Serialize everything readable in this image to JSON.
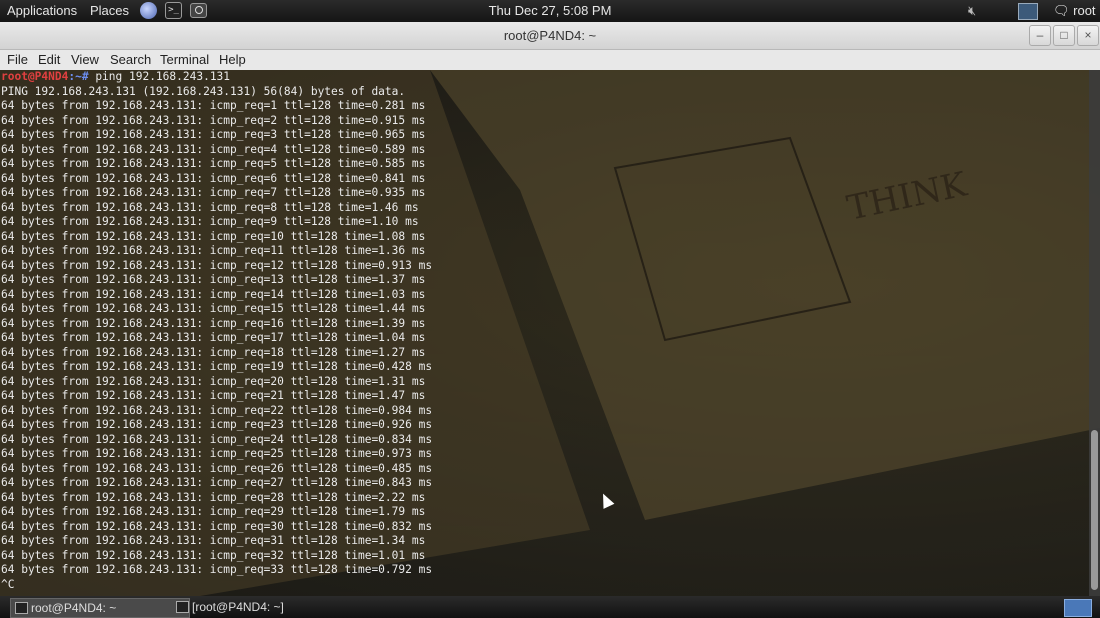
{
  "top_panel": {
    "applications": "Applications",
    "places": "Places",
    "clock": "Thu Dec 27,  5:08 PM",
    "user": "root",
    "icons": [
      "browser-icon",
      "terminal-icon",
      "screenshot-icon",
      "volume-muted-icon",
      "network-icon",
      "chat-icon"
    ]
  },
  "window": {
    "title": "root@P4ND4: ~",
    "minimize": "–",
    "maximize": "□",
    "close": "×"
  },
  "menubar": {
    "file": "File",
    "edit": "Edit",
    "view": "View",
    "search": "Search",
    "terminal": "Terminal",
    "help": "Help"
  },
  "terminal": {
    "prompt_user": "root@P4ND4",
    "prompt_path": ":~#",
    "command": " ping 192.168.243.131",
    "header": "PING 192.168.243.131 (192.168.243.131) 56(84) bytes of data.",
    "lines": [
      "64 bytes from 192.168.243.131: icmp_req=1 ttl=128 time=0.281 ms",
      "64 bytes from 192.168.243.131: icmp_req=2 ttl=128 time=0.915 ms",
      "64 bytes from 192.168.243.131: icmp_req=3 ttl=128 time=0.965 ms",
      "64 bytes from 192.168.243.131: icmp_req=4 ttl=128 time=0.589 ms",
      "64 bytes from 192.168.243.131: icmp_req=5 ttl=128 time=0.585 ms",
      "64 bytes from 192.168.243.131: icmp_req=6 ttl=128 time=0.841 ms",
      "64 bytes from 192.168.243.131: icmp_req=7 ttl=128 time=0.935 ms",
      "64 bytes from 192.168.243.131: icmp_req=8 ttl=128 time=1.46 ms",
      "64 bytes from 192.168.243.131: icmp_req=9 ttl=128 time=1.10 ms",
      "64 bytes from 192.168.243.131: icmp_req=10 ttl=128 time=1.08 ms",
      "64 bytes from 192.168.243.131: icmp_req=11 ttl=128 time=1.36 ms",
      "64 bytes from 192.168.243.131: icmp_req=12 ttl=128 time=0.913 ms",
      "64 bytes from 192.168.243.131: icmp_req=13 ttl=128 time=1.37 ms",
      "64 bytes from 192.168.243.131: icmp_req=14 ttl=128 time=1.03 ms",
      "64 bytes from 192.168.243.131: icmp_req=15 ttl=128 time=1.44 ms",
      "64 bytes from 192.168.243.131: icmp_req=16 ttl=128 time=1.39 ms",
      "64 bytes from 192.168.243.131: icmp_req=17 ttl=128 time=1.04 ms",
      "64 bytes from 192.168.243.131: icmp_req=18 ttl=128 time=1.27 ms",
      "64 bytes from 192.168.243.131: icmp_req=19 ttl=128 time=0.428 ms",
      "64 bytes from 192.168.243.131: icmp_req=20 ttl=128 time=1.31 ms",
      "64 bytes from 192.168.243.131: icmp_req=21 ttl=128 time=1.47 ms",
      "64 bytes from 192.168.243.131: icmp_req=22 ttl=128 time=0.984 ms",
      "64 bytes from 192.168.243.131: icmp_req=23 ttl=128 time=0.926 ms",
      "64 bytes from 192.168.243.131: icmp_req=24 ttl=128 time=0.834 ms",
      "64 bytes from 192.168.243.131: icmp_req=25 ttl=128 time=0.973 ms",
      "64 bytes from 192.168.243.131: icmp_req=26 ttl=128 time=0.485 ms",
      "64 bytes from 192.168.243.131: icmp_req=27 ttl=128 time=0.843 ms",
      "64 bytes from 192.168.243.131: icmp_req=28 ttl=128 time=2.22 ms",
      "64 bytes from 192.168.243.131: icmp_req=29 ttl=128 time=1.79 ms",
      "64 bytes from 192.168.243.131: icmp_req=30 ttl=128 time=0.832 ms",
      "64 bytes from 192.168.243.131: icmp_req=31 ttl=128 time=1.34 ms",
      "64 bytes from 192.168.243.131: icmp_req=32 ttl=128 time=1.01 ms",
      "64 bytes from 192.168.243.131: icmp_req=33 ttl=128 time=0.792 ms"
    ],
    "interrupt": "^C",
    "wallpaper_text": "THINK"
  },
  "taskbar": {
    "task1": "root@P4ND4: ~",
    "task2": "[root@P4ND4: ~]"
  },
  "colors": {
    "prompt_user": "#e04040",
    "prompt_path": "#6c8ef0",
    "text": "#eaeaea"
  }
}
